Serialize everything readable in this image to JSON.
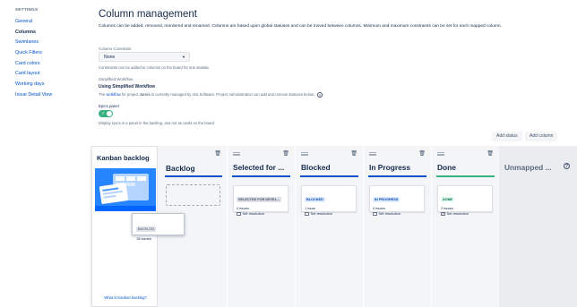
{
  "sidebar": {
    "heading": "SETTINGS",
    "items": [
      {
        "label": "General",
        "active": false
      },
      {
        "label": "Columns",
        "active": true
      },
      {
        "label": "Swimlanes",
        "active": false
      },
      {
        "label": "Quick Filters",
        "active": false
      },
      {
        "label": "Card colors",
        "active": false
      },
      {
        "label": "Card layout",
        "active": false
      },
      {
        "label": "Working days",
        "active": false
      },
      {
        "label": "Issue Detail View",
        "active": false
      }
    ]
  },
  "header": {
    "title": "Column management",
    "description": "Columns can be added, removed, reordered and renamed. Columns are based upon global statuses and can be moved between columns. Minimum and maximum constraints can be set for each mapped column."
  },
  "constraint": {
    "label": "Column Constraint",
    "value": "None",
    "help": "Constraints can be added to columns on the board for one statistic."
  },
  "workflow": {
    "label": "Simplified Workflow",
    "value": "Using Simplified Workflow",
    "help_prefix": "The ",
    "help_link": "workflow",
    "help_mid": " for project ",
    "project": "Jarvis",
    "help_suffix": " is currently managed by Jira Software. Project Administration can add and remove statuses below."
  },
  "epics": {
    "label": "Epics panel",
    "enabled": true,
    "help": "Display epics in a panel in the backlog, and not as cards on the board"
  },
  "buttons": {
    "add_status": "Add status",
    "add_column": "Add column"
  },
  "kanban_backlog": {
    "title": "Kanban backlog",
    "link": "What is Kanban backlog?",
    "tooltip_status": "BACKLOG",
    "tooltip_issues": "18 issues"
  },
  "columns": [
    {
      "name": "Backlog",
      "has_status": false,
      "underline_color": "#0052cc"
    },
    {
      "name": "Selected for ...",
      "has_status": true,
      "status": "SELECTED FOR DEVEL...",
      "issues": "0 issues",
      "resolution": "Set resolution",
      "resolution_checked": false,
      "lozenge_bg": "#dfe1e6",
      "lozenge_fg": "#42526e",
      "underline_color": "#0052cc"
    },
    {
      "name": "Blocked",
      "has_status": true,
      "status": "BLOCKED",
      "issues": "1 issue",
      "resolution": "Set resolution",
      "resolution_checked": false,
      "lozenge_bg": "#deebff",
      "lozenge_fg": "#0747a6",
      "underline_color": "#0052cc"
    },
    {
      "name": "In Progress",
      "has_status": true,
      "status": "IN PROGRESS",
      "issues": "0 issues",
      "resolution": "Set resolution",
      "resolution_checked": false,
      "lozenge_bg": "#deebff",
      "lozenge_fg": "#0747a6",
      "underline_color": "#0052cc"
    },
    {
      "name": "Done",
      "has_status": true,
      "status": "DONE",
      "issues": "2 issues",
      "resolution": "Set resolution",
      "resolution_checked": true,
      "lozenge_bg": "#e3fcef",
      "lozenge_fg": "#006644",
      "underline_color": "#36b37e"
    }
  ],
  "unmapped": {
    "title": "Unmapped ..."
  }
}
